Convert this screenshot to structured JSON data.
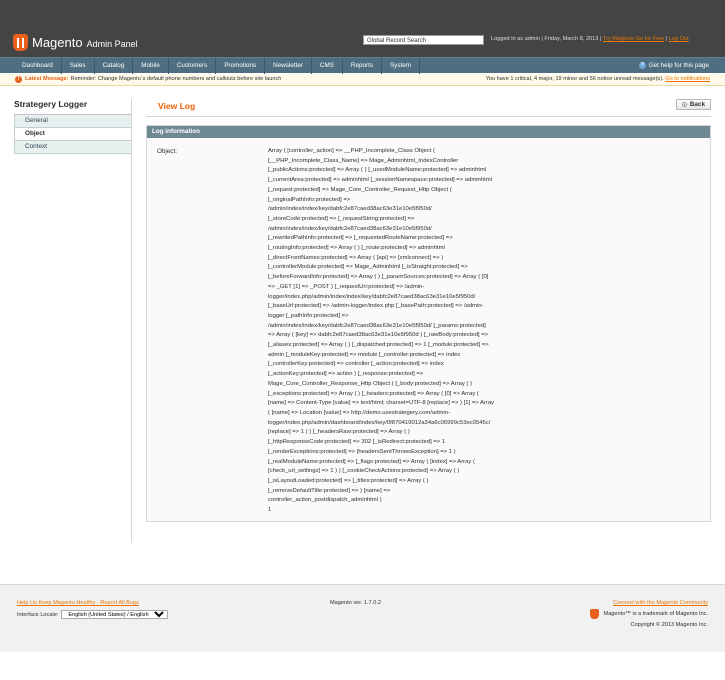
{
  "header": {
    "logo_text": "Magento",
    "logo_sub": "Admin Panel",
    "search_value": "Global Record Search",
    "logged_in": "Logged in as admin",
    "date": "Friday, March 8, 2013",
    "try_link": "Try Magento Go for Free",
    "logout_link": "Log Out",
    "sep": "|"
  },
  "nav": {
    "items": [
      "Dashboard",
      "Sales",
      "Catalog",
      "Mobile",
      "Customers",
      "Promotions",
      "Newsletter",
      "CMS",
      "Reports",
      "System"
    ],
    "help": "Get help for this page"
  },
  "message": {
    "label": "Latest Message:",
    "text": "Reminder: Change Magento`s default phone numbers and callouts before site launch",
    "summary": "You have 1 critical, 4 major, 19 minor and 56 notice unread message(s).",
    "link": "Go to notifications"
  },
  "sidebar": {
    "title": "Strategery Logger",
    "tabs": [
      "General",
      "Object",
      "Context"
    ],
    "active": 1
  },
  "content": {
    "title": "View Log",
    "back": "Back",
    "legend": "Log information",
    "field_label": "Object:",
    "field_value": "Array ( [controller_action] => __PHP_Incomplete_Class Object (\n[__PHP_Incomplete_Class_Name] => Mage_Adminhtml_IndexController\n[_publicActions:protected] => Array ( ) [_usedModuleName:protected] => adminhtml\n[_currentArea:protected] => adminhtml [_sessionNamespace:protected] => adminhtml\n[_request:protected] => Mage_Core_Controller_Request_Http Object (\n[_originalPathInfo:protected] =>\n/admin/index/index/key/dabfc2e87caed38ac63e31e10e5f950d/\n[_storeCode:protected] => [_requestString:protected] =>\n/admin/index/index/key/dabfc2e87caed38ac63e31e10e5f950d/\n[_rewritedPathInfo:protected] => [_requestedRouteName:protected] =>\n[_routingInfo:protected] => Array ( ) [_route:protected] => adminhtml\n[_directFrontNames:protected] => Array ( [api] => [xmlconnect] => )\n[_controllerModule:protected] => Mage_Adminhtml [_isStraight:protected] =>\n[_beforeForwardInfo:protected] => Array ( ) [_paramSources:protected] => Array ( [0]\n=> _GET [1] => _POST ) [_requestUri:protected] => /admin-\nlogger/index.php/admin/index/index/key/dabfc2e87caed38ac63e31e10e5f950d/\n[_baseUrl:protected] => /admin-logger/index.php [_basePath:protected] => /admin-\nlogger [_pathInfo:protected] =>\n/admin/index/index/key/dabfc2e87caed38ac63e31e10e5f950d/ [_params:protected]\n=> Array ( [key] => dabfc2e87caed38ac63e31e10e5f950d ) [_rawBody:protected] =>\n[_aliases:protected] => Array ( ) [_dispatched:protected] => 1 [_module:protected] =>\nadmin [_moduleKey:protected] => module [_controller:protected] => index\n[_controllerKey:protected] => controller [_action:protected] => index\n[_actionKey:protected] => action ) [_response:protected] =>\nMage_Core_Controller_Response_Http Object ( [_body:protected] => Array ( )\n[_exceptions:protected] => Array ( ) [_headers:protected] => Array ( [0] => Array (\n[name] => Content-Type [value] => text/html; charset=UTF-8 [replace] => ) [1] => Array\n( [name] => Location [value] => http://demo.usestrategery.com/admin-\nlogger/index.php/admin/dashboard/index/key/0f870419012a34a6c06999c53ec0545c/\n[replace] => 1 ) ) [_headersRaw:protected] => Array ( )\n[_httpResponseCode:protected] => 302 [_isRedirect:protected] => 1\n[_renderExceptions:protected] => [headersSentThrowsException] => 1 )\n[_realModuleName:protected] => [_flags:protected] => Array ( [index] => Array (\n[check_url_settings] => 1 ) ) [_cookieCheckActions:protected] => Array ( )\n[_isLayoutLoaded:protected] => [_titles:protected] => Array ( )\n[_removeDefaultTitle:protected] => ) [name] =>\ncontroller_action_postdispatch_adminhtml )\n1"
  },
  "footer": {
    "help_link": "Help Us Keep Magento Healthy - Report All Bugs",
    "locale_label": "Interface Locale:",
    "locale_value": "English (United States) / English",
    "version": "Magento ver. 1.7.0.2",
    "community_link": "Connect with the Magento Community",
    "trademark": "Magento™ is a trademark of Magento Inc.",
    "copyright": "Copyright © 2013 Magento Inc."
  },
  "colors": {
    "accent": "#eb5e00",
    "nav": "#4f6e81",
    "header": "#444444"
  }
}
